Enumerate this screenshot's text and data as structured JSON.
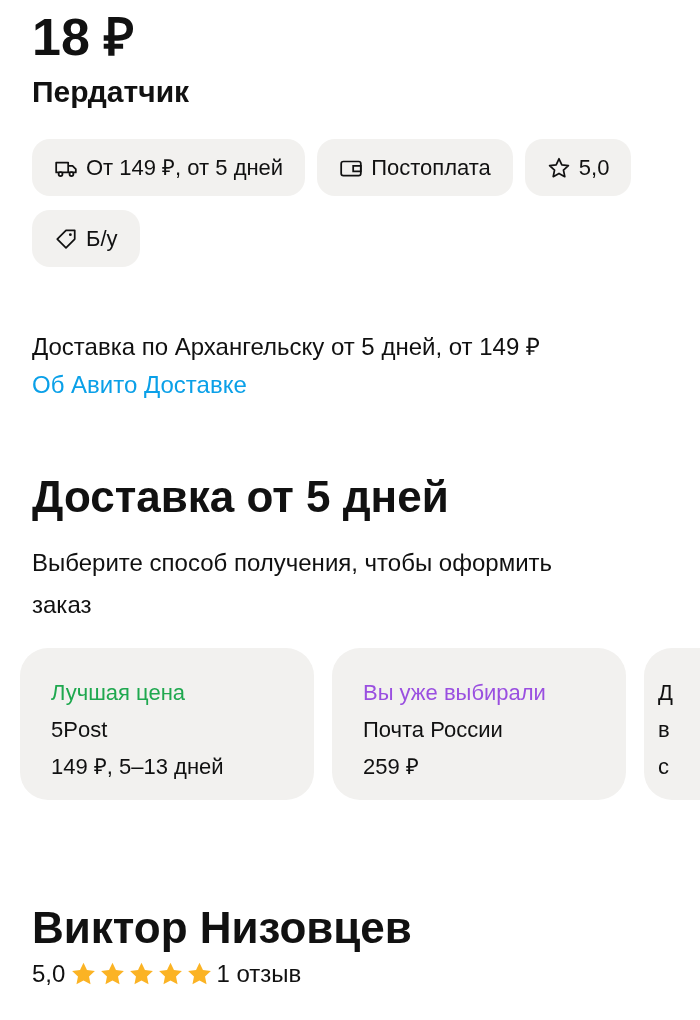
{
  "price": "18 ₽",
  "title": "Пердатчик",
  "chips": [
    {
      "kind": "truck",
      "label": "От 149 ₽, от 5 дней"
    },
    {
      "kind": "wallet",
      "label": "Постоплата"
    },
    {
      "kind": "star",
      "label": "5,0"
    },
    {
      "kind": "tag",
      "label": "Б/у"
    }
  ],
  "delivery_note": {
    "text": "Доставка по Архангельску от 5 дней, от 149 ₽",
    "link": "Об Авито Доставке"
  },
  "delivery": {
    "heading": "Доставка от 5 дней",
    "subtitle": "Выберите способ получения, чтобы оформить заказ",
    "options": [
      {
        "tag": "Лучшая цена",
        "color": "#1fa84f",
        "name": "5Post",
        "details": "149 ₽, 5–13 дней"
      },
      {
        "tag": "Вы уже выбирали",
        "color": "#9a4fe0",
        "name": "Почта России",
        "details": "259 ₽"
      },
      {
        "tag": "Д",
        "name": "в",
        "details": "с"
      }
    ]
  },
  "seller": {
    "name": "Виктор Низовцев",
    "rating": "5,0",
    "stars": 5,
    "reviews": "1 отзыв"
  }
}
